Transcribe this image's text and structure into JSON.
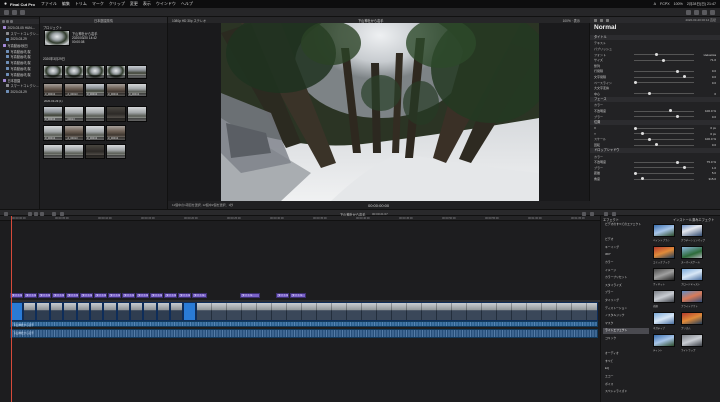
{
  "menubar": {
    "app_name": "Final Cut Pro",
    "items": [
      "ファイル",
      "編集",
      "トリム",
      "マーク",
      "クリップ",
      "変更",
      "表示",
      "ウインドウ",
      "ヘルプ"
    ],
    "status": [
      "A",
      "FCPX",
      "100%",
      "2月28日(日) 21:47"
    ]
  },
  "library": {
    "items": [
      {
        "label": "2020-03-05 HUN-...",
        "indent": false,
        "icon": "star"
      },
      {
        "label": "スマートコレクシ...",
        "indent": true,
        "icon": "folder"
      },
      {
        "label": "2020-03-29",
        "indent": true,
        "icon": "clip"
      },
      {
        "label": "写真動画/秋田",
        "indent": false,
        "icon": "star"
      },
      {
        "label": "写真動画/札幌",
        "indent": true,
        "icon": "clip"
      },
      {
        "label": "写真動画/札幌",
        "indent": true,
        "icon": "clip"
      },
      {
        "label": "写真動画/札幌",
        "indent": true,
        "icon": "clip"
      },
      {
        "label": "写真動画/札幌",
        "indent": true,
        "icon": "clip"
      },
      {
        "label": "写真動画/札幌",
        "indent": true,
        "icon": "clip"
      },
      {
        "label": "日本庭園",
        "indent": false,
        "icon": "star"
      },
      {
        "label": "スマートコレクシ...",
        "indent": true,
        "icon": "folder"
      },
      {
        "label": "2020-03-29",
        "indent": true,
        "icon": "clip"
      }
    ]
  },
  "browser": {
    "header": "日本庭園風情",
    "project_group": "プロジェクト",
    "project_name": "下山神社から岩手",
    "project_date": "2020/03/20 14:42",
    "project_duration": "00:00:08",
    "group_label": "2020年3月29日",
    "group_label2": "2020-03-29 (1)",
    "clip_captions": [
      "",
      "",
      "",
      "",
      "",
      "3_00013",
      "_2_00013",
      "3_00013",
      "3_00013",
      "3_00013",
      "3_00013",
      "_00013",
      "",
      "",
      "",
      "3_00013",
      "_2_00013",
      "3_00013",
      "3_00013",
      "",
      "",
      "",
      ""
    ]
  },
  "viewer": {
    "left_label": "1080p HD 30p ステレオ",
    "title": "下山神社から岩手",
    "zoom": "100%",
    "view": "表示",
    "timecode": "00:00:00:00",
    "status_left": "11個中の1項目を選択, 12個中2個を選択、1秒"
  },
  "inspector": {
    "header_info": "2020-03-20 00:14 直径",
    "blend_title": "Normal",
    "rows": [
      {
        "label": "タイトル",
        "value": "",
        "sec": true
      },
      {
        "label": "テキスト",
        "value": ""
      },
      {
        "label": "パブリッシュ",
        "value": ""
      },
      {
        "label": "フォント",
        "value": "Helvetica"
      },
      {
        "label": "サイズ",
        "value": "71.0"
      },
      {
        "label": "整列",
        "value": ""
      },
      {
        "label": "行間隔",
        "value": "0.0"
      },
      {
        "label": "文字間隔",
        "value": "0.0"
      },
      {
        "label": "ベースライン",
        "value": "0.0"
      },
      {
        "label": "大文字変換",
        "value": ""
      },
      {
        "label": "中心",
        "value": "0"
      },
      {
        "label": "フェース",
        "value": "",
        "sec": true
      },
      {
        "label": "カラー",
        "value": ""
      },
      {
        "label": "不透明度",
        "value": "100.0 %"
      },
      {
        "label": "ブラー",
        "value": "0.0"
      },
      {
        "label": "位置",
        "value": "",
        "sec": true
      },
      {
        "label": "X",
        "value": "0 px"
      },
      {
        "label": "Y",
        "value": "0 px"
      },
      {
        "label": "スケール",
        "value": "100.0 %"
      },
      {
        "label": "回転",
        "value": "0.0"
      },
      {
        "label": "ドロップシャドウ",
        "value": "",
        "sec": true
      },
      {
        "label": "カラー",
        "value": ""
      },
      {
        "label": "不透明度",
        "value": "75.0 %"
      },
      {
        "label": "ブラー",
        "value": "1.0"
      },
      {
        "label": "距離",
        "value": "5.0"
      },
      {
        "label": "角度",
        "value": "315.0"
      }
    ]
  },
  "timeline": {
    "title": "下山神社から岩手",
    "timecode_info": "00:00:21:07",
    "ruler_labels": [
      "00:00:00:00",
      "00:00:05:00",
      "00:00:10:00",
      "00:00:15:00",
      "00:00:20:00",
      "00:00:25:00",
      "00:00:30:00",
      "00:00:35:00",
      "00:00:40:00",
      "00:00:45:00",
      "00:00:50:00",
      "00:00:55:00",
      "00:01:00:00",
      "00:01:05:00"
    ],
    "title_clips": [
      "タイトル",
      "タイトル",
      "タイトル",
      "タイトル",
      "タイトル",
      "タイトル",
      "タイトル",
      "タイトル",
      "タイトル",
      "タイトル",
      "タイトル",
      "タイトル",
      "タイトル",
      "タイトル",
      "タイトル",
      "タイトル",
      "タイトル"
    ],
    "audio_label_1": "下山神社から岩手",
    "audio_label_2": "下山神社から岩手"
  },
  "effects": {
    "header_left": "エフェクト",
    "header_right": "インストール済みエフェクト",
    "categories": [
      "ビデオのすべてのエフェクト",
      "",
      "ビデオ",
      "キーイング",
      "360°",
      "カラー",
      "イメージ",
      "カラープリセット",
      "スタイライズ",
      "ブラー",
      "タイリング",
      "ディストーション",
      "ノスタルジック",
      "マスク",
      "ライトエフェクト",
      "コミック",
      "",
      "オーディオ",
      "すべて",
      "EQ",
      "エコー",
      "ボイス",
      "スペシャライズド"
    ],
    "selected_index": 14,
    "thumbs": [
      "ペイントブラシ",
      "グラデーションマップ",
      "コミックブック",
      "スーパースケール",
      "ヴィネット",
      "ブロードキャスト",
      "光線",
      "ブライトアウト",
      "ネガティブ",
      "プリズム",
      "ティント",
      "ライトラップ"
    ]
  }
}
